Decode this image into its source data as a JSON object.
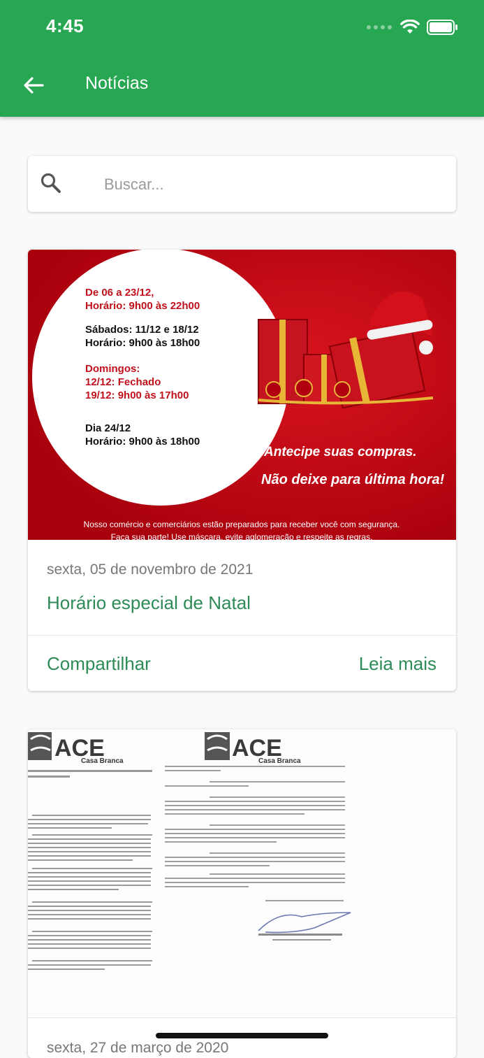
{
  "status_bar": {
    "time": "4:45"
  },
  "appbar": {
    "title": "Notícias",
    "back_icon": "arrow-left-icon"
  },
  "search": {
    "placeholder": "Buscar...",
    "value": "",
    "icon": "search-icon"
  },
  "colors": {
    "primary": "#27a751",
    "accent_text": "#2e8b57",
    "banner_red": "#c8101c"
  },
  "news": [
    {
      "date": "sexta, 05 de novembro de 2021",
      "title": "Horário especial de Natal",
      "share_label": "Compartilhar",
      "read_more_label": "Leia mais",
      "image": {
        "block1_line1": "De 06 a 23/12,",
        "block1_line2": "Horário: 9h00 às 22h00",
        "block2_line1": "Sábados: 11/12 e 18/12",
        "block2_line2": "Horário: 9h00 às 18h00",
        "block3_line1": "Domingos:",
        "block3_line2": "12/12: Fechado",
        "block3_line3": "19/12: 9h00 às 17h00",
        "block4_line1": "Dia 24/12",
        "block4_line2": "Horário: 9h00 às 18h00",
        "slogan_line1": "Antecipe suas compras.",
        "slogan_line2": "Não deixe para última hora!",
        "footer_line1": "Nosso comércio e comerciários estão preparados para receber você com segurança.",
        "footer_line2": "Faça sua parte! Use máscara, evite aglomeração e respeite as regras."
      }
    },
    {
      "date": "sexta, 27 de março de 2020",
      "image": {
        "logo_text": "ACE",
        "logo_sub": "Casa Branca"
      }
    }
  ]
}
